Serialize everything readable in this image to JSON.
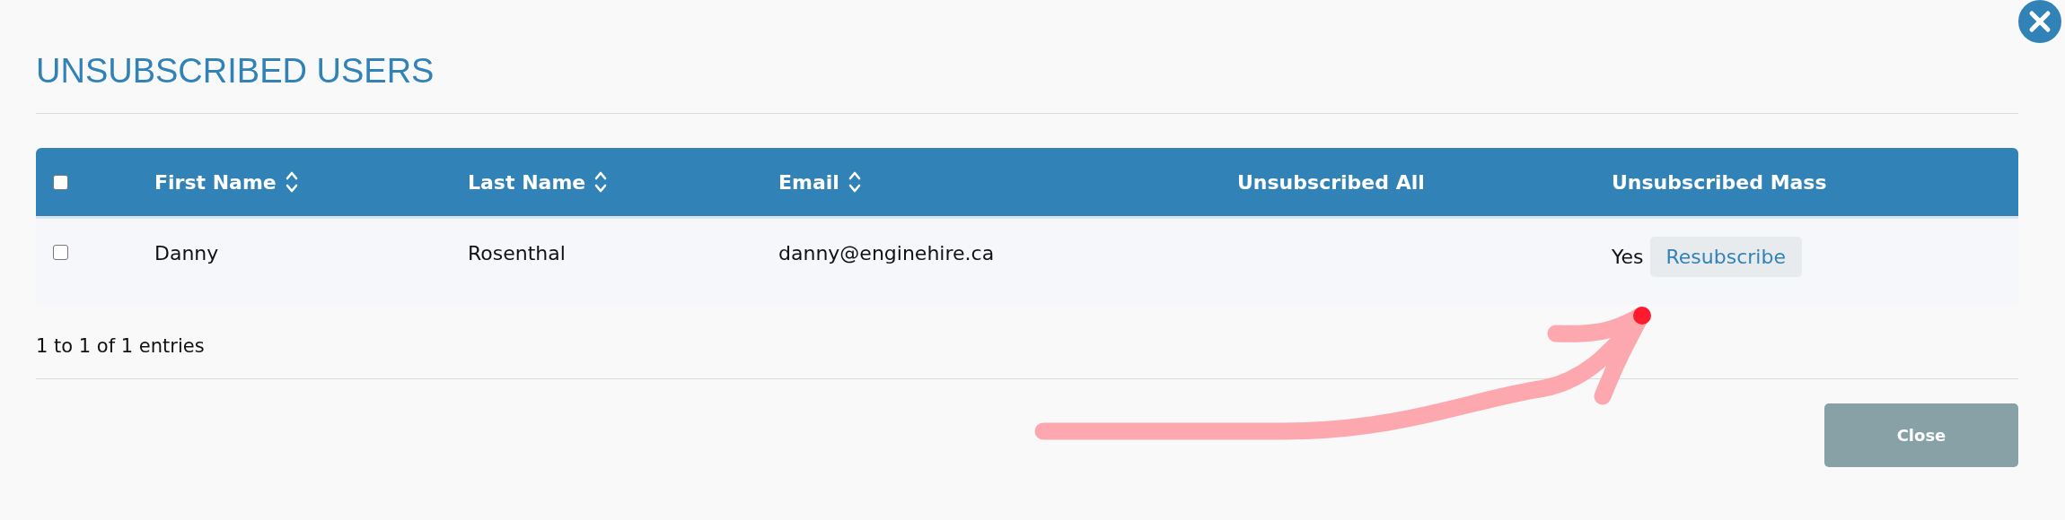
{
  "dialog": {
    "title": "UNSUBSCRIBED USERS"
  },
  "table": {
    "select_all": {
      "checked": false
    },
    "columns": [
      {
        "label": "First Name",
        "sortable": true
      },
      {
        "label": "Last Name",
        "sortable": true
      },
      {
        "label": "Email",
        "sortable": true
      },
      {
        "label": "Unsubscribed All",
        "sortable": false
      },
      {
        "label": "Unsubscribed Mass",
        "sortable": false
      }
    ],
    "rows": [
      {
        "checked": false,
        "first_name": "Danny",
        "last_name": "Rosenthal",
        "email": "danny@enginehire.ca",
        "unsubscribed_mass": "Yes",
        "action": "Resubscribe"
      }
    ]
  },
  "info": "1 to 1 of 1 entries",
  "buttons": [
    "Close"
  ]
}
